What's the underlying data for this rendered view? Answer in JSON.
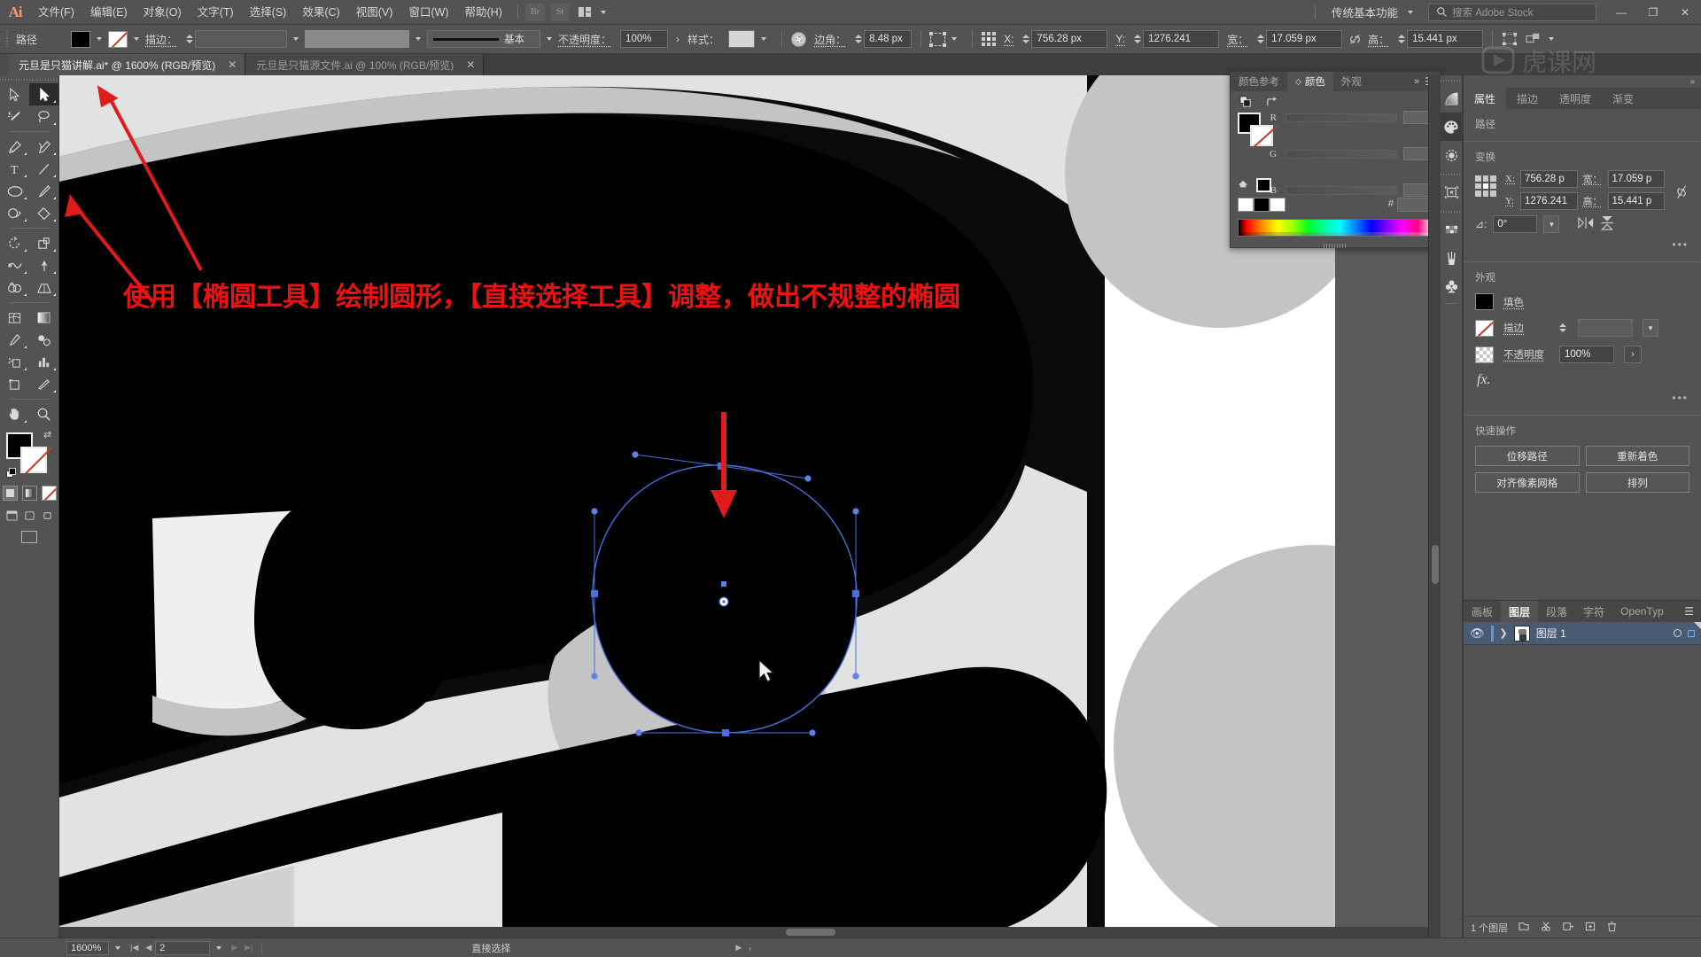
{
  "app": {
    "name": "Adobe Illustrator",
    "logo_text": "Ai"
  },
  "menubar": {
    "items": [
      {
        "label": "文件(F)",
        "name": "menu-file"
      },
      {
        "label": "编辑(E)",
        "name": "menu-edit"
      },
      {
        "label": "对象(O)",
        "name": "menu-object"
      },
      {
        "label": "文字(T)",
        "name": "menu-type"
      },
      {
        "label": "选择(S)",
        "name": "menu-select"
      },
      {
        "label": "效果(C)",
        "name": "menu-effect"
      },
      {
        "label": "视图(V)",
        "name": "menu-view"
      },
      {
        "label": "窗口(W)",
        "name": "menu-window"
      },
      {
        "label": "帮助(H)",
        "name": "menu-help"
      }
    ],
    "bridge_label": "Br",
    "stock_label": "St",
    "workspace": "传统基本功能",
    "search_placeholder": "搜索 Adobe Stock",
    "win_minimize": "—",
    "win_restore": "❐",
    "win_close": "✕"
  },
  "controlbar": {
    "object_type": "路径",
    "fill_color": "#000000",
    "stroke_color": "none",
    "stroke_label": "描边：",
    "stroke_weight": "",
    "stroke_variable": "",
    "stroke_profile": "基本",
    "opacity_label": "不透明度：",
    "opacity_value": "100%",
    "style_label": "样式：",
    "corner_label": "边角：",
    "corner_value": "8.48 px",
    "x_label": "X:",
    "x_value": "756.28 px",
    "y_label": "Y:",
    "y_value": "1276.241",
    "w_label": "宽：",
    "w_value": "17.059 px",
    "h_label": "高：",
    "h_value": "15.441 px"
  },
  "tabs": [
    {
      "label": "元旦是只猫讲解.ai* @ 1600% (RGB/预览)",
      "active": true,
      "close": "✕"
    },
    {
      "label": "元旦是只猫源文件.ai @ 100% (RGB/预览)",
      "active": false,
      "close": "✕"
    }
  ],
  "toolbar": {
    "tools": [
      {
        "name": "tool-selection",
        "icon": "cursor-arrow-outline-icon",
        "selected": false
      },
      {
        "name": "tool-direct-selection",
        "icon": "cursor-arrow-filled-icon",
        "selected": true
      },
      {
        "name": "tool-magic-wand",
        "icon": "magic-wand-icon",
        "selected": false
      },
      {
        "name": "tool-lasso",
        "icon": "lasso-icon",
        "selected": false
      },
      {
        "name": "tool-pen",
        "icon": "pen-icon",
        "selected": false
      },
      {
        "name": "tool-curvature",
        "icon": "curvature-icon",
        "selected": false
      },
      {
        "name": "tool-type",
        "icon": "type-t-icon",
        "selected": false
      },
      {
        "name": "tool-line-segment",
        "icon": "line-segment-icon",
        "selected": false
      },
      {
        "name": "tool-ellipse",
        "icon": "ellipse-icon",
        "selected": false
      },
      {
        "name": "tool-paintbrush",
        "icon": "paintbrush-icon",
        "selected": false
      },
      {
        "name": "tool-shaper",
        "icon": "shaper-icon",
        "selected": false
      },
      {
        "name": "tool-eraser",
        "icon": "eraser-icon",
        "selected": false
      },
      {
        "name": "tool-rotate",
        "icon": "rotate-icon",
        "selected": false
      },
      {
        "name": "tool-scale",
        "icon": "scale-icon",
        "selected": false
      },
      {
        "name": "tool-width",
        "icon": "width-icon",
        "selected": false
      },
      {
        "name": "tool-free-transform",
        "icon": "free-transform-icon",
        "selected": false
      },
      {
        "name": "tool-shape-builder",
        "icon": "shape-builder-icon",
        "selected": false
      },
      {
        "name": "tool-perspective-grid",
        "icon": "perspective-grid-icon",
        "selected": false
      },
      {
        "name": "tool-mesh",
        "icon": "mesh-icon",
        "selected": false
      },
      {
        "name": "tool-gradient",
        "icon": "gradient-icon",
        "selected": false
      },
      {
        "name": "tool-eyedropper",
        "icon": "eyedropper-icon",
        "selected": false
      },
      {
        "name": "tool-blend",
        "icon": "blend-icon",
        "selected": false
      },
      {
        "name": "tool-symbol-sprayer",
        "icon": "symbol-sprayer-icon",
        "selected": false
      },
      {
        "name": "tool-column-graph",
        "icon": "bar-chart-icon",
        "selected": false
      },
      {
        "name": "tool-artboard",
        "icon": "artboard-icon",
        "selected": false
      },
      {
        "name": "tool-slice",
        "icon": "slice-knife-icon",
        "selected": false
      },
      {
        "name": "tool-hand",
        "icon": "hand-icon",
        "selected": false
      },
      {
        "name": "tool-zoom",
        "icon": "magnifier-icon",
        "selected": false
      }
    ],
    "fill_color": "#000000",
    "stroke_color": "none"
  },
  "annotation": {
    "text": "使用【椭圆工具】绘制圆形，【直接选择工具】调整，做出不规整的椭圆",
    "color": "#ee1111"
  },
  "color_panel": {
    "tabs": [
      {
        "label": "颜色参考",
        "active": false
      },
      {
        "label": "颜色",
        "active": true
      },
      {
        "label": "外观",
        "active": false
      }
    ],
    "channels": [
      "R",
      "G",
      "B"
    ],
    "hex_label": "#",
    "hex_value": "",
    "r_value": "",
    "g_value": "",
    "b_value": ""
  },
  "properties": {
    "tabs": [
      {
        "label": "属性",
        "active": true
      },
      {
        "label": "描边",
        "active": false
      },
      {
        "label": "透明度",
        "active": false
      },
      {
        "label": "渐变",
        "active": false
      }
    ],
    "object_title": "路径",
    "transform_title": "变换",
    "x_label": "X:",
    "x_value": "756.28 p",
    "y_label": "Y:",
    "y_value": "1276.241",
    "w_label": "宽：",
    "w_value": "17.059 p",
    "h_label": "高：",
    "h_value": "15.441 p",
    "angle_label": "⊿:",
    "angle_value": "0°",
    "appearance_title": "外观",
    "fill_label": "填色",
    "stroke_label": "描边",
    "stroke_weight": "",
    "opacity_label": "不透明度",
    "opacity_value": "100%",
    "fx_label": "fx.",
    "quick_actions_title": "快速操作",
    "quick_actions": [
      {
        "label": "位移路径",
        "name": "offset-path-button"
      },
      {
        "label": "重新着色",
        "name": "recolor-button"
      },
      {
        "label": "对齐像素网格",
        "name": "align-pixel-grid-button"
      },
      {
        "label": "排列",
        "name": "arrange-button"
      }
    ]
  },
  "layers_panel": {
    "tabs": [
      {
        "label": "画板",
        "active": false
      },
      {
        "label": "图层",
        "active": true
      },
      {
        "label": "段落",
        "active": false
      },
      {
        "label": "字符",
        "active": false
      },
      {
        "label": "OpenTyp",
        "active": false
      }
    ],
    "rows": [
      {
        "name": "图层 1",
        "visible": true,
        "locked": false
      }
    ],
    "footer_count": "1 个图层"
  },
  "statusbar": {
    "zoom": "1600%",
    "artboard_number": "2",
    "tool_status": "直接选择"
  },
  "canvas": {
    "background": "#0a0a0a",
    "shape_light": "#e2e2e2",
    "shape_mid": "#c4c4c4",
    "shape_dark": "#000000",
    "selection_color": "#4a6ee0",
    "arrow_color": "#e01b1b",
    "selected_path_name": "irregular-ellipse-path"
  }
}
